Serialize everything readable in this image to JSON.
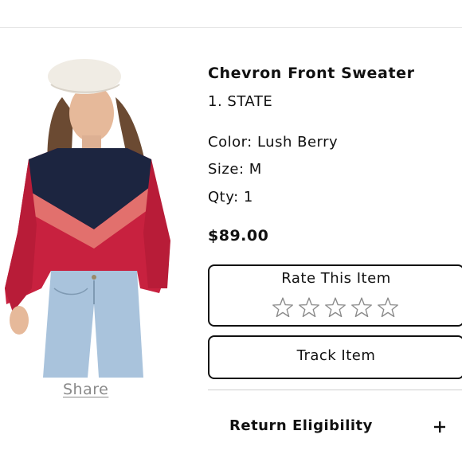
{
  "product": {
    "title": "Chevron Front Sweater",
    "brand": "1. STATE",
    "color": "Color: Lush Berry",
    "size": "Size: M",
    "qty": "Qty: 1",
    "price": "$89.00",
    "image_icon": "model-wearing-chevron-sweater-photo"
  },
  "share_label": "Share",
  "rating": {
    "label": "Rate This Item",
    "stars_total": 5,
    "stars_filled": 0
  },
  "track_label": "Track Item",
  "return_section": {
    "label": "Return Eligibility",
    "expand_icon": "plus-icon"
  },
  "colors": {
    "sweater_navy": "#1c2540",
    "sweater_pink": "#e2706d",
    "sweater_berry": "#c8213f",
    "denim": "#a9c3dc",
    "beret": "#f0ece4"
  }
}
